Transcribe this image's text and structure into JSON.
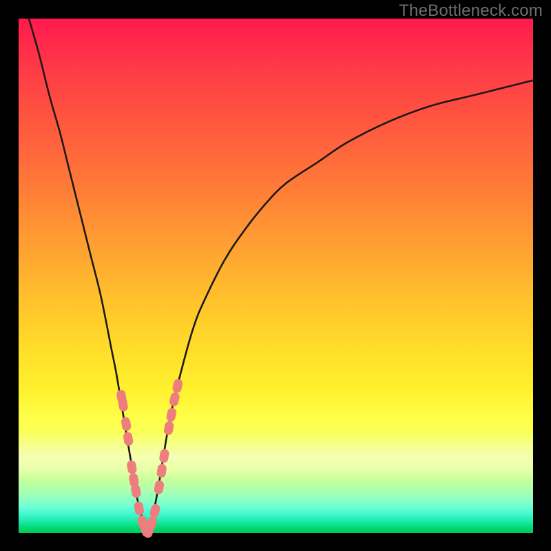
{
  "watermark": "TheBottleneck.com",
  "chart_data": {
    "type": "line",
    "title": "",
    "xlabel": "",
    "ylabel": "",
    "xlim": [
      0,
      100
    ],
    "ylim": [
      0,
      100
    ],
    "series": [
      {
        "name": "left-branch",
        "x": [
          2,
          4,
          6,
          8,
          10,
          12,
          14,
          16,
          18,
          19,
          20,
          21,
          22,
          23,
          24,
          25
        ],
        "y": [
          100,
          93,
          85,
          78,
          70,
          62,
          54,
          46,
          36,
          31,
          25,
          19,
          13,
          7,
          3,
          0
        ]
      },
      {
        "name": "right-branch",
        "x": [
          25,
          26,
          27,
          28,
          29,
          30,
          32,
          34,
          36,
          40,
          44,
          48,
          52,
          58,
          64,
          72,
          80,
          88,
          96,
          100
        ],
        "y": [
          0,
          3,
          8,
          14,
          20,
          25,
          33,
          40,
          45,
          53,
          59,
          64,
          68,
          72,
          76,
          80,
          83,
          85,
          87,
          88
        ]
      }
    ],
    "markers": {
      "name": "highlight-pills",
      "color": "#ee7d7d",
      "points": [
        {
          "x": 20.0,
          "y": 26.5
        },
        {
          "x": 20.3,
          "y": 25.0
        },
        {
          "x": 20.9,
          "y": 21.2
        },
        {
          "x": 21.3,
          "y": 18.3
        },
        {
          "x": 22.0,
          "y": 12.8
        },
        {
          "x": 22.4,
          "y": 10.3
        },
        {
          "x": 22.8,
          "y": 8.2
        },
        {
          "x": 23.4,
          "y": 4.8
        },
        {
          "x": 24.1,
          "y": 2.1
        },
        {
          "x": 24.7,
          "y": 0.6
        },
        {
          "x": 25.3,
          "y": 0.4
        },
        {
          "x": 25.9,
          "y": 1.9
        },
        {
          "x": 26.5,
          "y": 4.3
        },
        {
          "x": 27.3,
          "y": 8.9
        },
        {
          "x": 27.8,
          "y": 12.1
        },
        {
          "x": 28.3,
          "y": 15.0
        },
        {
          "x": 29.2,
          "y": 20.4
        },
        {
          "x": 29.7,
          "y": 23.0
        },
        {
          "x": 30.3,
          "y": 26.0
        },
        {
          "x": 30.9,
          "y": 28.6
        }
      ]
    }
  },
  "colors": {
    "curve": "#1a1a1a",
    "markers": "#ee7d7d",
    "frame": "#000000"
  }
}
